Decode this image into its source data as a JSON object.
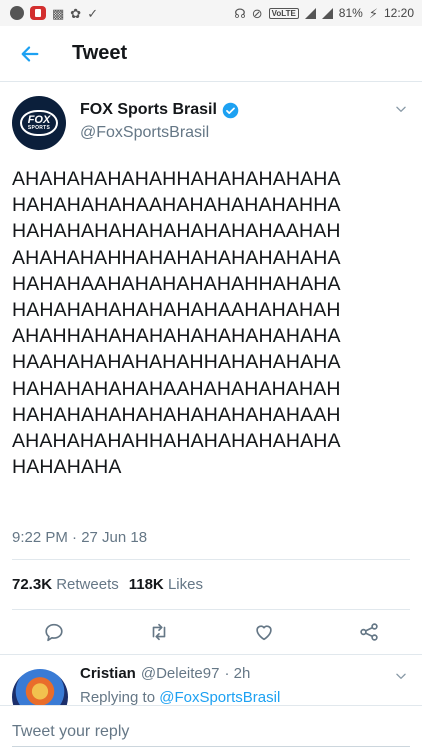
{
  "status_bar": {
    "battery": "81%",
    "time": "12:20",
    "network": "VoLTE",
    "icons": [
      "app-icon",
      "youtube-icon",
      "gallery-icon",
      "twitter-icon",
      "check-icon",
      "headphones-icon",
      "mute-icon",
      "signal-icon",
      "battery-icon"
    ]
  },
  "header": {
    "title": "Tweet",
    "back_icon": "arrow-left-icon"
  },
  "tweet": {
    "author": {
      "display_name": "FOX Sports Brasil",
      "handle": "@FoxSportsBrasil",
      "verified": true,
      "avatar_text_1": "FOX",
      "avatar_text_2": "SPORTS"
    },
    "text_lines": [
      "AHAHAHAHAHAHHAHAHAHAHAHA",
      "HAHAHAHAHAAHAHAHAHAHAHHA",
      "HAHAHAHAHAHAHAHAHAHAAHAH",
      "AHAHAHAHHAHAHAHAHAHAHAHA",
      "HAHAHAAHAHAHAHAHAHHAHAHA",
      "HAHAHAHAHAHAHAHAAHAHAHAH",
      "AHAHHAHAHAHAHAHAHAHAHAHA",
      "HAAHAHAHAHAHAHHAHAHAHAHA",
      "HAHAHAHAHAHAAHAHAHAHAHAH",
      "HAHAHAHAHAHAHAHAHAHAHAAH",
      "AHAHAHAHAHHAHAHAHAHAHAHA",
      "HAHAHAHA"
    ],
    "timestamp": "9:22 PM · 27 Jun 18",
    "retweets_count": "72.3K",
    "retweets_label": "Retweets",
    "likes_count": "118K",
    "likes_label": "Likes",
    "actions": [
      "reply-icon",
      "retweet-icon",
      "like-icon",
      "share-icon"
    ]
  },
  "reply_preview": {
    "name": "Cristian",
    "handle": "@Deleite97",
    "time": "· 2h",
    "context_prefix": "Replying to ",
    "context_link": "@FoxSportsBrasil"
  },
  "composer": {
    "placeholder": "Tweet your reply"
  },
  "colors": {
    "accent": "#1da1f2",
    "muted": "#657786",
    "text": "#14171a",
    "divider": "#e1e8ed"
  }
}
